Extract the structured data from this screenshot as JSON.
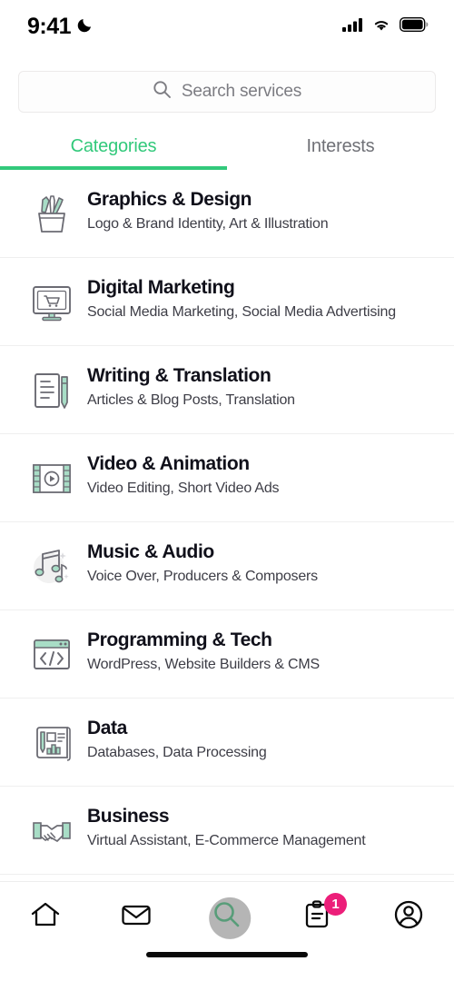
{
  "status_bar": {
    "time": "9:41",
    "dnd_icon": "moon-icon",
    "signal_icon": "cellular-signal-icon",
    "wifi_icon": "wifi-icon",
    "battery_icon": "battery-full-icon"
  },
  "search": {
    "icon": "search-icon",
    "placeholder": "Search services",
    "value": ""
  },
  "tabs": {
    "active_index": 0,
    "items": [
      {
        "label": "Categories",
        "active": true
      },
      {
        "label": "Interests",
        "active": false
      }
    ]
  },
  "categories": [
    {
      "title": "Graphics & Design",
      "subtitle": "Logo & Brand Identity, Art & Illustration",
      "icon": "pencil-cup-icon"
    },
    {
      "title": "Digital Marketing",
      "subtitle": "Social Media Marketing, Social Media Advertising",
      "icon": "monitor-cart-icon"
    },
    {
      "title": "Writing & Translation",
      "subtitle": "Articles & Blog Posts, Translation",
      "icon": "document-pen-icon"
    },
    {
      "title": "Video & Animation",
      "subtitle": "Video Editing, Short Video Ads",
      "icon": "film-play-icon"
    },
    {
      "title": "Music & Audio",
      "subtitle": "Voice Over, Producers & Composers",
      "icon": "music-notes-icon"
    },
    {
      "title": "Programming & Tech",
      "subtitle": "WordPress, Website Builders & CMS",
      "icon": "browser-code-icon"
    },
    {
      "title": "Data",
      "subtitle": "Databases, Data Processing",
      "icon": "data-chart-icon"
    },
    {
      "title": "Business",
      "subtitle": "Virtual Assistant, E-Commerce Management",
      "icon": "handshake-icon"
    }
  ],
  "bottom_nav": {
    "items": [
      {
        "icon": "home-icon",
        "active": false,
        "badge": ""
      },
      {
        "icon": "mail-icon",
        "active": false,
        "badge": ""
      },
      {
        "icon": "search-icon",
        "active": true,
        "badge": ""
      },
      {
        "icon": "orders-clipboard-icon",
        "active": false,
        "badge": "1"
      },
      {
        "icon": "account-circle-icon",
        "active": false,
        "badge": ""
      }
    ]
  },
  "colors": {
    "accent_green": "#32c97b",
    "icon_mint": "#a8ddc6",
    "icon_outline": "#6b6b73",
    "badge_pink": "#ec1e79",
    "title_text": "#10101a",
    "subtitle_text": "#3d3d46",
    "inactive_tab": "#6f7076",
    "placeholder_text": "#7c7c82"
  }
}
